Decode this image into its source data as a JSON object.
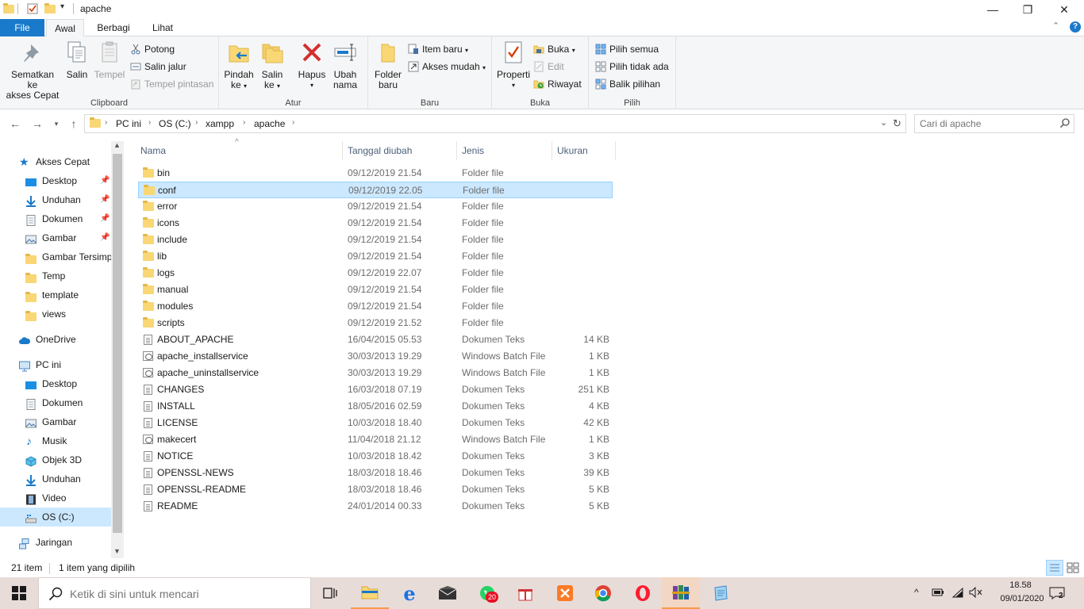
{
  "window": {
    "title": "apache",
    "controls": {
      "minimize": "—",
      "maximize": "❐",
      "close": "✕"
    }
  },
  "ribbon_tabs": [
    "File",
    "Awal",
    "Berbagi",
    "Lihat"
  ],
  "ribbon": {
    "clipboard": {
      "label": "Clipboard",
      "pin": "Sematkan ke akses Cepat",
      "pin_line1": "Sematkan ke",
      "pin_line2": "akses Cepat",
      "copy": "Salin",
      "paste": "Tempel",
      "cut": "Potong",
      "copy_path": "Salin jalur",
      "paste_shortcut": "Tempel pintasan"
    },
    "organize": {
      "label": "Atur",
      "move_to_1": "Pindah",
      "move_to_2": "ke",
      "copy_to_1": "Salin",
      "copy_to_2": "ke",
      "delete": "Hapus",
      "rename_1": "Ubah",
      "rename_2": "nama"
    },
    "new": {
      "label": "Baru",
      "new_folder_1": "Folder",
      "new_folder_2": "baru",
      "new_item": "Item baru",
      "easy_access": "Akses mudah"
    },
    "open": {
      "label": "Buka",
      "properties": "Properti",
      "open": "Buka",
      "edit": "Edit",
      "history": "Riwayat"
    },
    "select": {
      "label": "Pilih",
      "select_all": "Pilih semua",
      "select_none": "Pilih tidak ada",
      "invert": "Balik pilihan"
    }
  },
  "address": {
    "crumbs": [
      "PC ini",
      "OS (C:)",
      "xampp",
      "apache"
    ],
    "search_placeholder": "Cari di apache"
  },
  "nav_pane": {
    "quick_access": "Akses Cepat",
    "quick_items": [
      {
        "label": "Desktop",
        "pinned": true
      },
      {
        "label": "Unduhan",
        "pinned": true
      },
      {
        "label": "Dokumen",
        "pinned": true
      },
      {
        "label": "Gambar",
        "pinned": true
      },
      {
        "label": "Gambar Tersimpan",
        "pinned": false
      },
      {
        "label": "Temp",
        "pinned": false
      },
      {
        "label": "template",
        "pinned": false
      },
      {
        "label": "views",
        "pinned": false
      }
    ],
    "onedrive": "OneDrive",
    "this_pc": "PC ini",
    "pc_items": [
      "Desktop",
      "Dokumen",
      "Gambar",
      "Musik",
      "Objek 3D",
      "Unduhan",
      "Video",
      "OS (C:)"
    ],
    "network": "Jaringan"
  },
  "columns": {
    "name": "Nama",
    "date": "Tanggal diubah",
    "type": "Jenis",
    "size": "Ukuran"
  },
  "files": [
    {
      "name": "bin",
      "date": "09/12/2019 21.54",
      "type": "Folder file",
      "size": "",
      "kind": "folder"
    },
    {
      "name": "conf",
      "date": "09/12/2019 22.05",
      "type": "Folder file",
      "size": "",
      "kind": "folder",
      "selected": true
    },
    {
      "name": "error",
      "date": "09/12/2019 21.54",
      "type": "Folder file",
      "size": "",
      "kind": "folder"
    },
    {
      "name": "icons",
      "date": "09/12/2019 21.54",
      "type": "Folder file",
      "size": "",
      "kind": "folder"
    },
    {
      "name": "include",
      "date": "09/12/2019 21.54",
      "type": "Folder file",
      "size": "",
      "kind": "folder"
    },
    {
      "name": "lib",
      "date": "09/12/2019 21.54",
      "type": "Folder file",
      "size": "",
      "kind": "folder"
    },
    {
      "name": "logs",
      "date": "09/12/2019 22.07",
      "type": "Folder file",
      "size": "",
      "kind": "folder"
    },
    {
      "name": "manual",
      "date": "09/12/2019 21.54",
      "type": "Folder file",
      "size": "",
      "kind": "folder"
    },
    {
      "name": "modules",
      "date": "09/12/2019 21.54",
      "type": "Folder file",
      "size": "",
      "kind": "folder"
    },
    {
      "name": "scripts",
      "date": "09/12/2019 21.52",
      "type": "Folder file",
      "size": "",
      "kind": "folder"
    },
    {
      "name": "ABOUT_APACHE",
      "date": "16/04/2015 05.53",
      "type": "Dokumen Teks",
      "size": "14 KB",
      "kind": "doc"
    },
    {
      "name": "apache_installservice",
      "date": "30/03/2013 19.29",
      "type": "Windows Batch File",
      "size": "1 KB",
      "kind": "bat"
    },
    {
      "name": "apache_uninstallservice",
      "date": "30/03/2013 19.29",
      "type": "Windows Batch File",
      "size": "1 KB",
      "kind": "bat"
    },
    {
      "name": "CHANGES",
      "date": "16/03/2018 07.19",
      "type": "Dokumen Teks",
      "size": "251 KB",
      "kind": "doc"
    },
    {
      "name": "INSTALL",
      "date": "18/05/2016 02.59",
      "type": "Dokumen Teks",
      "size": "4 KB",
      "kind": "doc"
    },
    {
      "name": "LICENSE",
      "date": "10/03/2018 18.40",
      "type": "Dokumen Teks",
      "size": "42 KB",
      "kind": "doc"
    },
    {
      "name": "makecert",
      "date": "11/04/2018 21.12",
      "type": "Windows Batch File",
      "size": "1 KB",
      "kind": "bat"
    },
    {
      "name": "NOTICE",
      "date": "10/03/2018 18.42",
      "type": "Dokumen Teks",
      "size": "3 KB",
      "kind": "doc"
    },
    {
      "name": "OPENSSL-NEWS",
      "date": "18/03/2018 18.46",
      "type": "Dokumen Teks",
      "size": "39 KB",
      "kind": "doc"
    },
    {
      "name": "OPENSSL-README",
      "date": "18/03/2018 18.46",
      "type": "Dokumen Teks",
      "size": "5 KB",
      "kind": "doc"
    },
    {
      "name": "README",
      "date": "24/01/2014 00.33",
      "type": "Dokumen Teks",
      "size": "5 KB",
      "kind": "doc"
    }
  ],
  "status": {
    "count": "21 item",
    "selection": "1 item yang dipilih"
  },
  "taskbar": {
    "search_placeholder": "Ketik di sini untuk mencari",
    "whatsapp_badge": "20",
    "time": "18.58",
    "date": "09/01/2020",
    "notifications": "2"
  },
  "colors": {
    "file_tab": "#1979ca",
    "selection": "#cce8ff",
    "folder": "#f8d774",
    "taskbar": "#e8dcd9"
  }
}
